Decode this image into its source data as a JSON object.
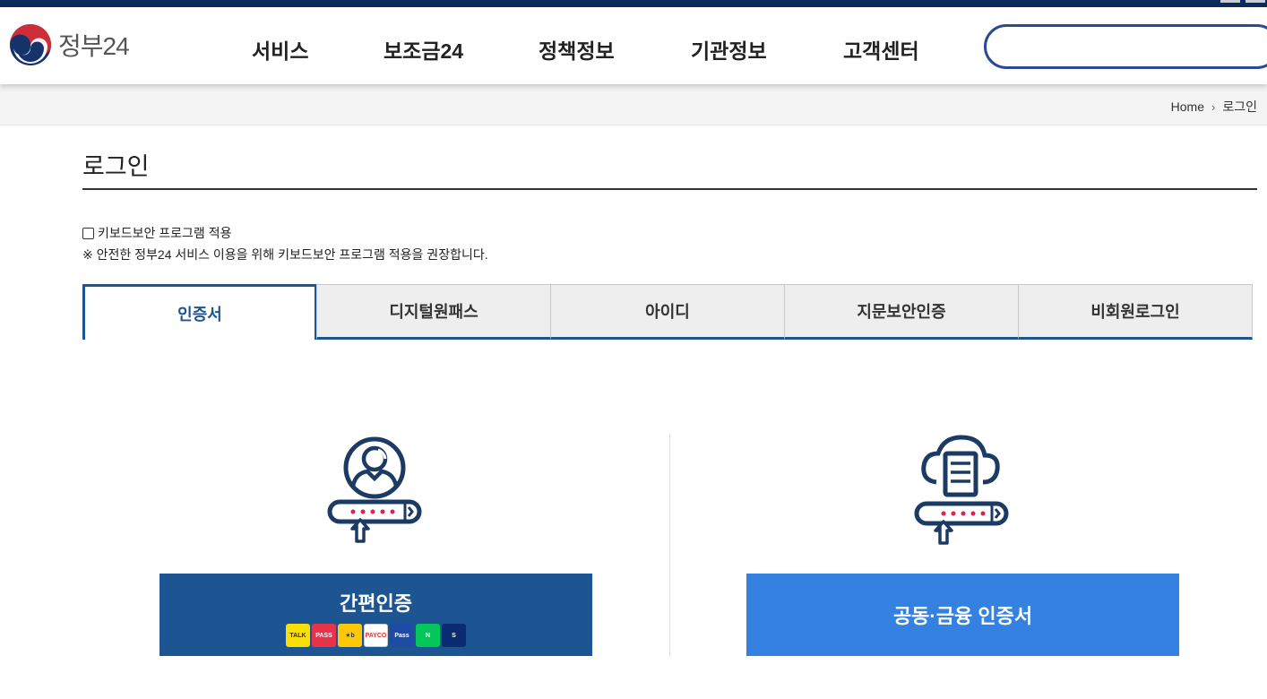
{
  "header": {
    "logo_text": "정부24",
    "nav": [
      "서비스",
      "보조금24",
      "정책정보",
      "기관정보",
      "고객센터"
    ],
    "search_value": ""
  },
  "breadcrumb": {
    "home": "Home",
    "current": "로그인"
  },
  "page_title": "로그인",
  "keyboard_security": {
    "checkbox_label": "키보드보안 프로그램 적용",
    "checked": false,
    "note": "※ 안전한 정부24 서비스 이용을 위해 키보드보안 프로그램 적용을 권장합니다."
  },
  "tabs": [
    "인증서",
    "디지털원패스",
    "아이디",
    "지문보안인증",
    "비회원로그인"
  ],
  "active_tab": "인증서",
  "buttons": {
    "simple_auth": "간편인증",
    "joint_cert": "공동·금융 인증서"
  },
  "providers": [
    {
      "name": "kakao",
      "label": "TALK",
      "bg": "#f9e000",
      "fg": "#3b1e1e"
    },
    {
      "name": "pass",
      "label": "PASS",
      "bg": "#e8344a",
      "fg": "#ffffff"
    },
    {
      "name": "kb",
      "label": "★b",
      "bg": "#fec70a",
      "fg": "#3b3b3b"
    },
    {
      "name": "payco",
      "label": "PAYCO",
      "bg": "#ffffff",
      "fg": "#e5302a"
    },
    {
      "name": "samsung-pass",
      "label": "Pass",
      "bg": "#1f4ba5",
      "fg": "#ffffff"
    },
    {
      "name": "naver",
      "label": "N",
      "bg": "#03c75a",
      "fg": "#ffffff"
    },
    {
      "name": "shinhan",
      "label": "S",
      "bg": "#0b2a6f",
      "fg": "#ffffff"
    }
  ],
  "colors": {
    "top_bar": "#0d2a5c",
    "tab_accent": "#1d5592",
    "simple_auth_bg": "#1d5592",
    "joint_cert_bg": "#3481e2",
    "icon_navy": "#1c3b64",
    "icon_red": "#e0204d"
  }
}
